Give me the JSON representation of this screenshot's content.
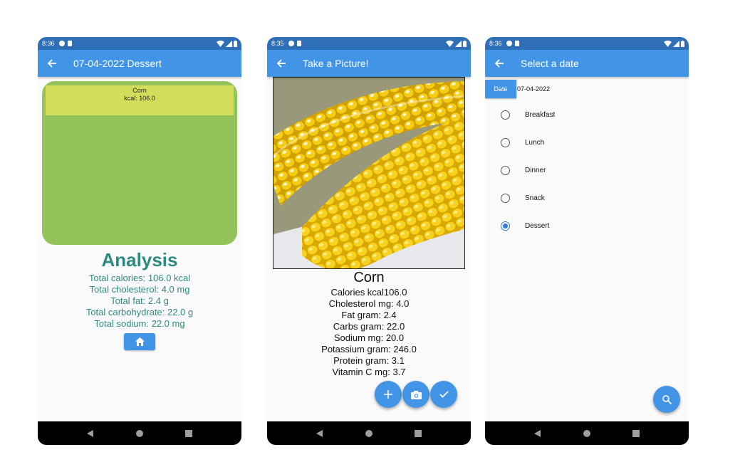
{
  "colors": {
    "primary": "#4294e6",
    "status_bar": "#2f6fb8",
    "analysis_text": "#2e8a80",
    "card_bg": "#94c35b",
    "card_item_bg": "#d4dd5b"
  },
  "screen1": {
    "status_time": "8:36",
    "title": "07-04-2022 Dessert",
    "card_item": {
      "name": "Corn",
      "kcal": "kcal: 106.0"
    },
    "analysis_title": "Analysis",
    "analysis_lines": [
      "Total calories: 106.0 kcal",
      "Total cholesterol: 4.0 mg",
      "Total fat: 2.4 g",
      "Total carbohydrate: 22.0 g",
      "Total sodium: 22.0 mg"
    ],
    "home_icon": "home-icon"
  },
  "screen2": {
    "status_time": "8:35",
    "title": "Take a Picture!",
    "food_name": "Corn",
    "food_lines": [
      "Calories kcal106.0",
      "Cholesterol mg: 4.0",
      "Fat gram: 2.4",
      "Carbs gram: 22.0",
      "Sodium mg: 20.0",
      "Potassium gram: 246.0",
      "Protein gram: 3.1",
      "Vitamin C mg: 3.7"
    ],
    "fab_icons": [
      "add-icon",
      "camera-icon",
      "check-icon"
    ]
  },
  "screen3": {
    "status_time": "8:36",
    "title": "Select a date",
    "date_button": "Date",
    "date_value": "07-04-2022",
    "meal_options": [
      "Breakfast",
      "Lunch",
      "Dinner",
      "Snack",
      "Dessert"
    ],
    "selected_meal": "Dessert",
    "fab_icon": "search-icon"
  }
}
